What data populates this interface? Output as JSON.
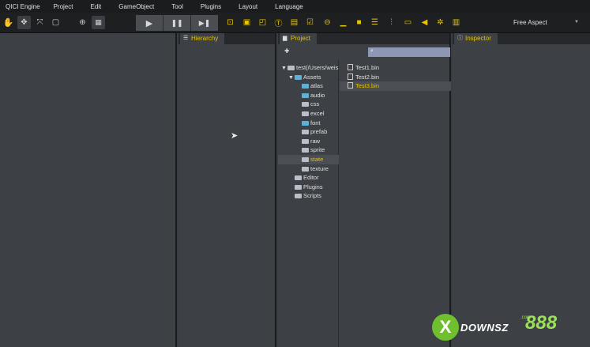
{
  "menu": [
    "QICI Engine",
    "Project",
    "Edit",
    "GameObject",
    "Tool",
    "Plugins",
    "Layout",
    "Language"
  ],
  "toolbar": {
    "aspect": "Free Aspect",
    "play_icon": "▶",
    "pause_icon": "❚❚",
    "step_icon": "▶❚"
  },
  "panels": {
    "hierarchy": "Hierarchy",
    "project": "Project",
    "inspector": "Inspector"
  },
  "project": {
    "add_label": "+",
    "search_value": "",
    "tree": [
      {
        "label": "test(/Users/weis",
        "depth": 0,
        "caret": "▼",
        "icon": "folder"
      },
      {
        "label": "Assets",
        "depth": 1,
        "caret": "▼",
        "icon": "folder-blue"
      },
      {
        "label": "atlas",
        "depth": 2,
        "caret": "",
        "icon": "folder-blue"
      },
      {
        "label": "audio",
        "depth": 2,
        "caret": "",
        "icon": "folder-blue"
      },
      {
        "label": "css",
        "depth": 2,
        "caret": "",
        "icon": "folder"
      },
      {
        "label": "excel",
        "depth": 2,
        "caret": "",
        "icon": "folder"
      },
      {
        "label": "font",
        "depth": 2,
        "caret": "",
        "icon": "folder-blue"
      },
      {
        "label": "prefab",
        "depth": 2,
        "caret": "",
        "icon": "folder"
      },
      {
        "label": "raw",
        "depth": 2,
        "caret": "",
        "icon": "folder"
      },
      {
        "label": "sprite",
        "depth": 2,
        "caret": "",
        "icon": "folder"
      },
      {
        "label": "state",
        "depth": 2,
        "caret": "",
        "icon": "folder",
        "selected": true
      },
      {
        "label": "texture",
        "depth": 2,
        "caret": "",
        "icon": "folder"
      },
      {
        "label": "Editor",
        "depth": 1,
        "caret": "",
        "icon": "folder"
      },
      {
        "label": "Plugins",
        "depth": 1,
        "caret": "",
        "icon": "folder"
      },
      {
        "label": "Scripts",
        "depth": 1,
        "caret": "",
        "icon": "folder"
      }
    ],
    "files": [
      {
        "label": "Test1.bin"
      },
      {
        "label": "Test2.bin"
      },
      {
        "label": "Test3.bin",
        "selected": true
      }
    ]
  },
  "watermark": {
    "text": "DOWNSZ",
    "number": "888",
    "com": ".com",
    "x": "X"
  },
  "colors": {
    "accent": "#e6c400",
    "panel_bg": "#3d4045",
    "menubar_bg": "#1b1c1e"
  }
}
